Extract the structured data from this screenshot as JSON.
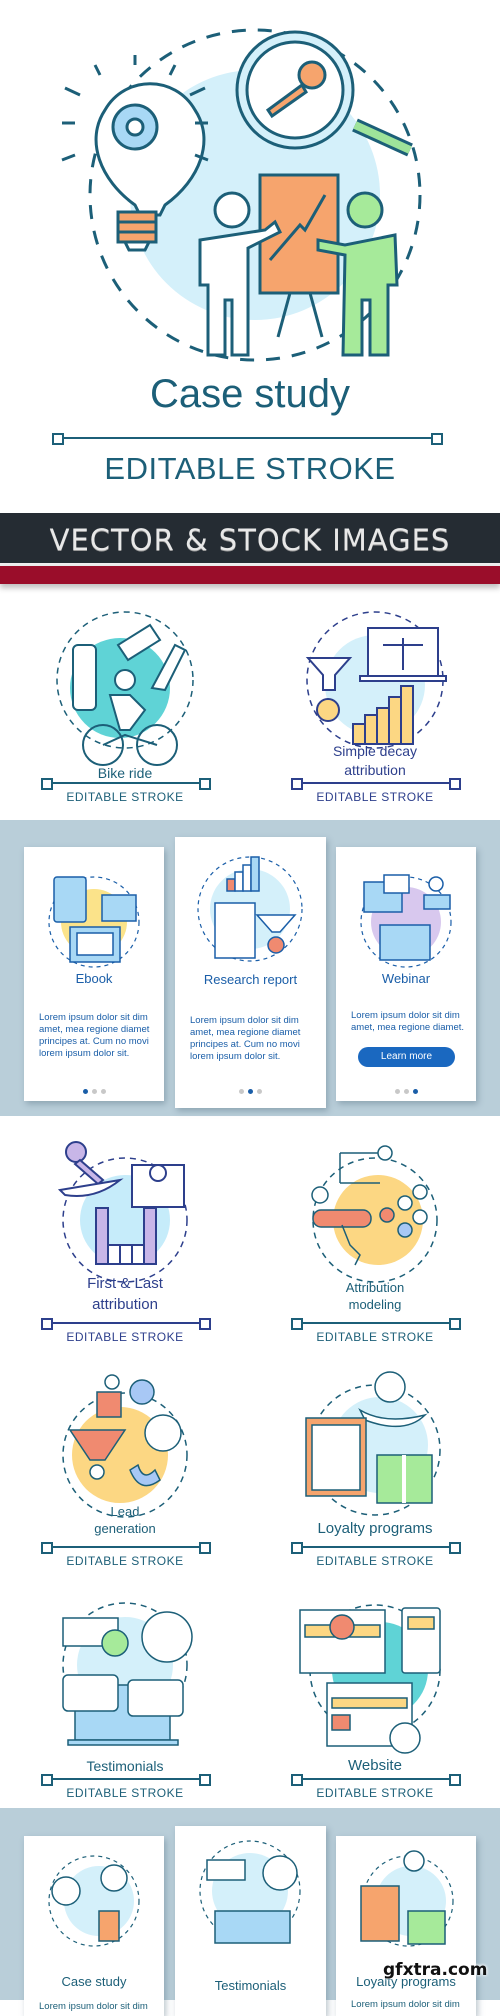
{
  "hero": {
    "title": "Case study",
    "subtitle": "EDITABLE STROKE"
  },
  "banner": {
    "text": "VECTOR & STOCK IMAGES"
  },
  "colors": {
    "teal": "#1c5f78",
    "navy": "#2d3f8c",
    "banner_dark": "#252c33",
    "banner_red": "#9a0d2a",
    "card_blue": "#1a5ea8",
    "card_bg": "#b9ced9"
  },
  "concepts_row1": [
    {
      "title": "Bike ride",
      "editable": "EDITABLE STROKE"
    },
    {
      "title_line1": "Simple decay",
      "title_line2": "attribution",
      "editable": "EDITABLE STROKE"
    }
  ],
  "cards_top": [
    {
      "title": "Ebook",
      "body": "Lorem ipsum dolor sit dim amet, mea regione diamet principes at. Cum no movi lorem ipsum dolor sit.",
      "active_dot": 1
    },
    {
      "title": "Research report",
      "body": "Lorem ipsum dolor sit dim amet, mea regione diamet principes at. Cum no movi lorem ipsum dolor sit.",
      "active_dot": 2
    },
    {
      "title": "Webinar",
      "body": "Lorem ipsum dolor sit dim amet, mea regione diamet.",
      "button": "Learn more",
      "active_dot": 3
    }
  ],
  "concepts_row2": [
    {
      "title_line1": "First & Last",
      "title_line2": "attribution",
      "editable": "EDITABLE STROKE"
    },
    {
      "title_line1": "Attribution",
      "title_line2": "modeling",
      "editable": "EDITABLE STROKE"
    }
  ],
  "concepts_row3": [
    {
      "title_line1": "Lead",
      "title_line2": "generation",
      "editable": "EDITABLE STROKE"
    },
    {
      "title": "Loyalty programs",
      "editable": "EDITABLE STROKE"
    }
  ],
  "concepts_row4": [
    {
      "title": "Testimonials",
      "editable": "EDITABLE STROKE"
    },
    {
      "title": "Website",
      "editable": "EDITABLE STROKE"
    }
  ],
  "cards_bottom": [
    {
      "title": "Case study",
      "body": "Lorem ipsum dolor sit dim"
    },
    {
      "title": "Testimonials"
    },
    {
      "title": "Loyalty programs",
      "body": "Lorem ipsum dolor sit dim"
    }
  ],
  "watermark": "gfxtra.com"
}
